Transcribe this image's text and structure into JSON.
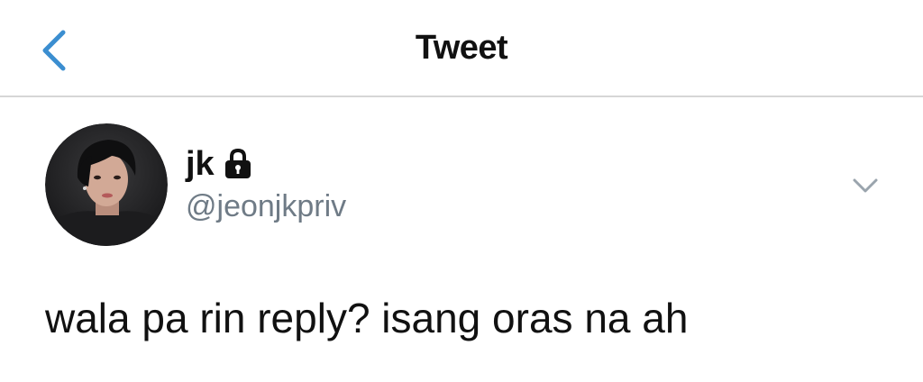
{
  "nav": {
    "title": "Tweet",
    "back_icon": "chevron-left-icon",
    "accent_color": "#3b8ed0"
  },
  "tweet": {
    "author": {
      "display_name": "jk",
      "handle": "@jeonjkpriv",
      "protected_icon": "lock-icon",
      "avatar_description_icon": "avatar"
    },
    "menu_icon": "chevron-down-icon",
    "text": "wala pa rin reply? isang oras na ah"
  },
  "colors": {
    "text_primary": "#111111",
    "text_secondary": "#6f7b86",
    "divider": "#d6d6d6",
    "back_arrow": "#3b8ed0",
    "chevron_gray": "#9aa4ad"
  }
}
